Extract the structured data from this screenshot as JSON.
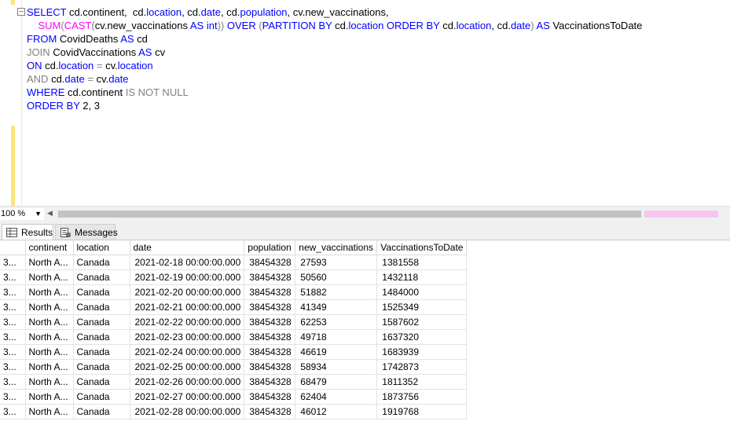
{
  "editor": {
    "lines": [
      [
        {
          "t": "SELECT",
          "c": "kw"
        },
        {
          "t": " cd.continent,  cd.",
          "c": ""
        },
        {
          "t": "location",
          "c": "kw"
        },
        {
          "t": ", cd.",
          "c": ""
        },
        {
          "t": "date",
          "c": "kw"
        },
        {
          "t": ", cd.",
          "c": ""
        },
        {
          "t": "population",
          "c": "kw"
        },
        {
          "t": ", cv.new_vaccinations,",
          "c": ""
        }
      ],
      [
        {
          "t": "    ",
          "c": ""
        },
        {
          "t": "SUM",
          "c": "fn"
        },
        {
          "t": "(",
          "c": "gr"
        },
        {
          "t": "CAST",
          "c": "fn"
        },
        {
          "t": "(",
          "c": "gr"
        },
        {
          "t": "cv.new_vaccinations ",
          "c": ""
        },
        {
          "t": "AS",
          "c": "kw"
        },
        {
          "t": " ",
          "c": ""
        },
        {
          "t": "int",
          "c": "kw"
        },
        {
          "t": ")) ",
          "c": "gr"
        },
        {
          "t": "OVER",
          "c": "kw"
        },
        {
          "t": " (",
          "c": "gr"
        },
        {
          "t": "PARTITION BY",
          "c": "kw"
        },
        {
          "t": " cd.",
          "c": ""
        },
        {
          "t": "location",
          "c": "kw"
        },
        {
          "t": " ",
          "c": ""
        },
        {
          "t": "ORDER BY",
          "c": "kw"
        },
        {
          "t": " cd.",
          "c": ""
        },
        {
          "t": "location",
          "c": "kw"
        },
        {
          "t": ", cd.",
          "c": ""
        },
        {
          "t": "date",
          "c": "kw"
        },
        {
          "t": ") ",
          "c": "gr"
        },
        {
          "t": "AS",
          "c": "kw"
        },
        {
          "t": " VaccinationsToDate",
          "c": ""
        }
      ],
      [
        {
          "t": "FROM",
          "c": "kw"
        },
        {
          "t": " CovidDeaths ",
          "c": ""
        },
        {
          "t": "AS",
          "c": "kw"
        },
        {
          "t": " cd",
          "c": ""
        }
      ],
      [
        {
          "t": "JOIN",
          "c": "gr"
        },
        {
          "t": " CovidVaccinations ",
          "c": ""
        },
        {
          "t": "AS",
          "c": "kw"
        },
        {
          "t": " cv",
          "c": ""
        }
      ],
      [
        {
          "t": "ON",
          "c": "kw"
        },
        {
          "t": " cd.",
          "c": ""
        },
        {
          "t": "location",
          "c": "kw"
        },
        {
          "t": " ",
          "c": ""
        },
        {
          "t": "=",
          "c": "gr"
        },
        {
          "t": " cv.",
          "c": ""
        },
        {
          "t": "location",
          "c": "kw"
        }
      ],
      [
        {
          "t": "AND",
          "c": "gr"
        },
        {
          "t": " cd.",
          "c": ""
        },
        {
          "t": "date",
          "c": "kw"
        },
        {
          "t": " ",
          "c": ""
        },
        {
          "t": "=",
          "c": "gr"
        },
        {
          "t": " cv.",
          "c": ""
        },
        {
          "t": "date",
          "c": "kw"
        }
      ],
      [
        {
          "t": "WHERE",
          "c": "kw"
        },
        {
          "t": " cd.continent ",
          "c": ""
        },
        {
          "t": "IS NOT NULL",
          "c": "gr"
        }
      ],
      [
        {
          "t": "ORDER BY",
          "c": "kw"
        },
        {
          "t": " 2, 3",
          "c": ""
        }
      ]
    ]
  },
  "zoom": "100 %",
  "tabs": {
    "results": "Results",
    "messages": "Messages"
  },
  "grid": {
    "headers": [
      "",
      "continent",
      "location",
      "date",
      "population",
      "new_vaccinations",
      "VaccinationsToDate"
    ],
    "rows": [
      [
        "3...",
        "North A...",
        "Canada",
        "2021-02-18 00:00:00.000",
        "38454328",
        "27593",
        "1381558"
      ],
      [
        "3...",
        "North A...",
        "Canada",
        "2021-02-19 00:00:00.000",
        "38454328",
        "50560",
        "1432118"
      ],
      [
        "3...",
        "North A...",
        "Canada",
        "2021-02-20 00:00:00.000",
        "38454328",
        "51882",
        "1484000"
      ],
      [
        "3...",
        "North A...",
        "Canada",
        "2021-02-21 00:00:00.000",
        "38454328",
        "41349",
        "1525349"
      ],
      [
        "3...",
        "North A...",
        "Canada",
        "2021-02-22 00:00:00.000",
        "38454328",
        "62253",
        "1587602"
      ],
      [
        "3...",
        "North A...",
        "Canada",
        "2021-02-23 00:00:00.000",
        "38454328",
        "49718",
        "1637320"
      ],
      [
        "3...",
        "North A...",
        "Canada",
        "2021-02-24 00:00:00.000",
        "38454328",
        "46619",
        "1683939"
      ],
      [
        "3...",
        "North A...",
        "Canada",
        "2021-02-25 00:00:00.000",
        "38454328",
        "58934",
        "1742873"
      ],
      [
        "3...",
        "North A...",
        "Canada",
        "2021-02-26 00:00:00.000",
        "38454328",
        "68479",
        "1811352"
      ],
      [
        "3...",
        "North A...",
        "Canada",
        "2021-02-27 00:00:00.000",
        "38454328",
        "62404",
        "1873756"
      ],
      [
        "3...",
        "North A...",
        "Canada",
        "2021-02-28 00:00:00.000",
        "38454328",
        "46012",
        "1919768"
      ]
    ]
  }
}
